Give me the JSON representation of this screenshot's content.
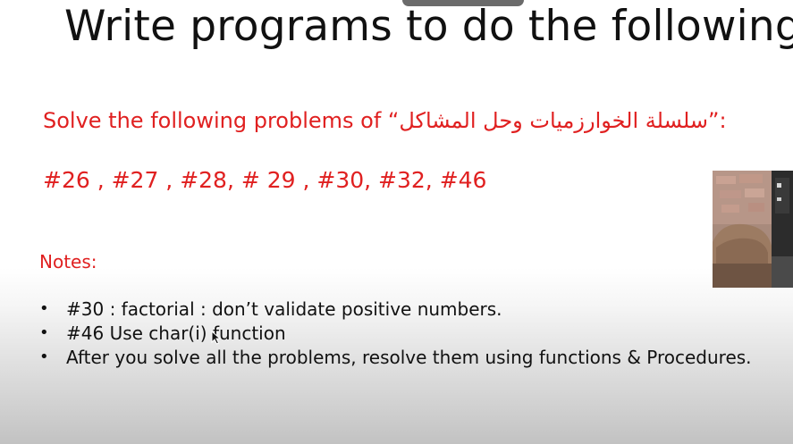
{
  "slide": {
    "title": "Write programs to do the following:",
    "subtitle_prefix": "Solve the following problems of “",
    "subtitle_arabic": "سلسلة الخوارزميات وحل المشاكل",
    "subtitle_suffix": "”:",
    "problems": "#26 , #27 , #28, # 29 , #30, #32, #46",
    "notes_heading": "Notes:",
    "notes": [
      "#30 : factorial : don’t validate positive numbers.",
      "#46 Use char(i) function",
      "After you solve all the problems, resolve them using functions & Procedures."
    ],
    "bullet": "•"
  },
  "icons": {
    "cursor": "mouse-pointer-icon"
  },
  "colors": {
    "accent_red": "#e02020",
    "text_dark": "#111111"
  }
}
